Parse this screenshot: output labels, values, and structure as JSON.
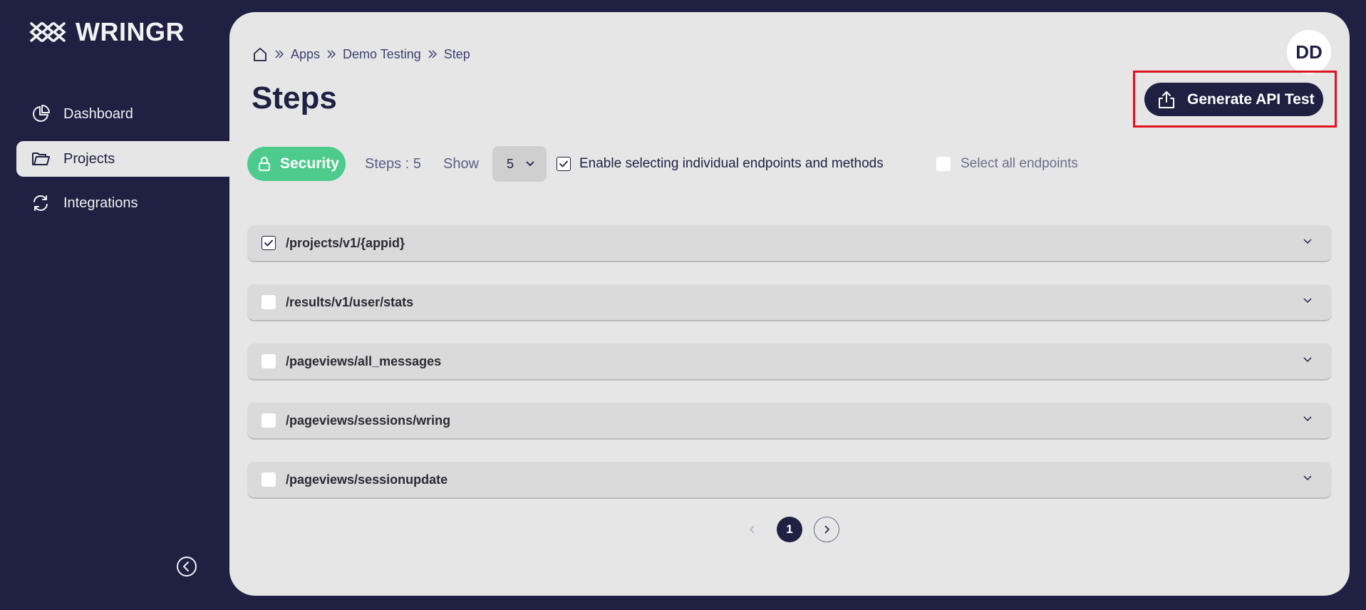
{
  "app": {
    "name": "WRINGR"
  },
  "sidebar": {
    "items": [
      {
        "label": "Dashboard",
        "icon": "pie-chart-icon"
      },
      {
        "label": "Projects",
        "icon": "folder-icon",
        "active": true
      },
      {
        "label": "Integrations",
        "icon": "refresh-icon"
      }
    ]
  },
  "breadcrumb": {
    "items": [
      "Apps",
      "Demo Testing",
      "Step"
    ]
  },
  "user": {
    "initials": "DD"
  },
  "page": {
    "title": "Steps"
  },
  "actions": {
    "generate_label": "Generate API Test"
  },
  "toolbar": {
    "security_label": "Security",
    "steps_count": "Steps : 5",
    "show_label": "Show",
    "show_value": "5",
    "enable_label": "Enable selecting individual endpoints and methods",
    "enable_checked": true,
    "select_all_label": "Select all endpoints",
    "select_all_checked": false
  },
  "endpoints": [
    {
      "path": "/projects/v1/{appid}",
      "checked": true
    },
    {
      "path": "/results/v1/user/stats",
      "checked": false
    },
    {
      "path": "/pageviews/all_messages",
      "checked": false
    },
    {
      "path": "/pageviews/sessions/wring",
      "checked": false
    },
    {
      "path": "/pageviews/sessionupdate",
      "checked": false
    }
  ],
  "pagination": {
    "current_page": "1"
  },
  "colors": {
    "brand_dark": "#1f2042",
    "panel_bg": "#e6e6e6",
    "accent_green": "#4ccb8c",
    "highlight_red": "#e0141e"
  }
}
